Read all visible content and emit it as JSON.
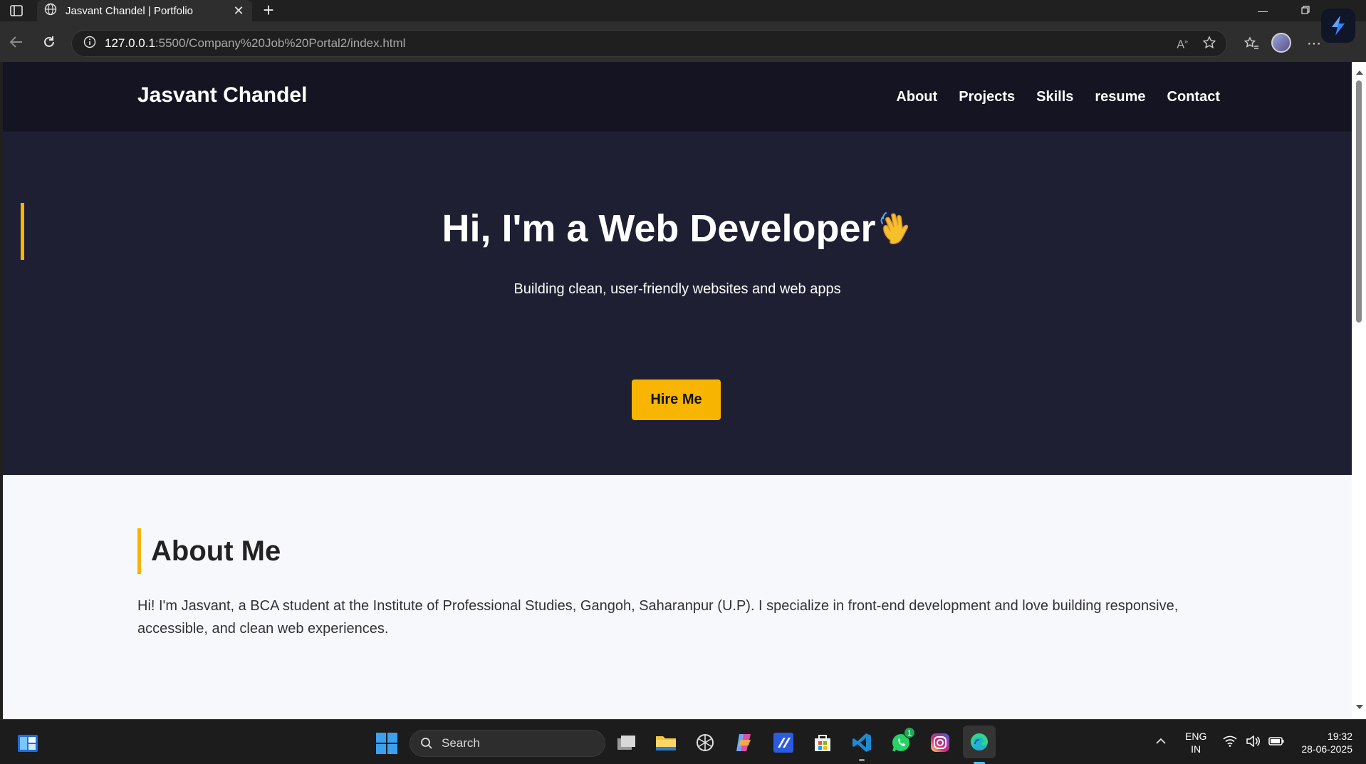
{
  "browser": {
    "tab_title": "Jasvant Chandel | Portfolio",
    "url_host": "127.0.0.1",
    "url_rest": ":5500/Company%20Job%20Portal2/index.html"
  },
  "site": {
    "brand": "Jasvant Chandel",
    "nav": [
      "About",
      "Projects",
      "Skills",
      "resume",
      "Contact"
    ],
    "hero": {
      "title": "Hi, I'm a Web Developer",
      "emoji": "👋",
      "subtitle": "Building clean, user-friendly websites and web apps",
      "cta": "Hire Me"
    },
    "about": {
      "heading": "About Me",
      "body": "Hi! I'm Jasvant, a BCA student at the Institute of Professional Studies, Gangoh, Saharanpur (U.P). I specialize in front-end development and love building responsive, accessible, and clean web experiences."
    }
  },
  "taskbar": {
    "search_placeholder": "Search",
    "lang_line1": "ENG",
    "lang_line2": "IN",
    "time": "19:32",
    "date": "28-06-2025",
    "whatsapp_badge": "1"
  },
  "colors": {
    "accent": "#f7b500",
    "hero_bg": "#1f1f33",
    "header_bg": "#141423",
    "about_bg": "#f7f8fb"
  }
}
